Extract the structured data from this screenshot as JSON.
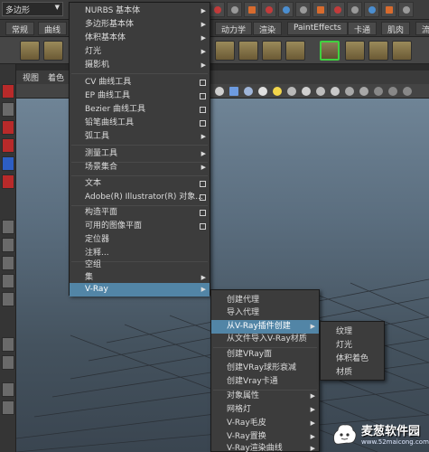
{
  "app": {
    "mode_dropdown": "多边形",
    "shelf_tabs": [
      "常规",
      "曲线",
      "动力学",
      "渲染",
      "PaintEffects",
      "卡通",
      "肌肉",
      "流"
    ],
    "panel_menu": [
      "视图",
      "着色"
    ]
  },
  "create_menu": {
    "items": [
      {
        "label": "NURBS 基本体",
        "submenu": true
      },
      {
        "label": "多边形基本体",
        "submenu": true
      },
      {
        "label": "体积基本体",
        "submenu": true
      },
      {
        "label": "灯光",
        "submenu": true
      },
      {
        "label": "摄影机",
        "submenu": true
      },
      {
        "label": "CV 曲线工具",
        "option_box": true
      },
      {
        "label": "EP 曲线工具",
        "option_box": true
      },
      {
        "label": "Bezier 曲线工具",
        "option_box": true
      },
      {
        "label": "铅笔曲线工具",
        "option_box": true
      },
      {
        "label": "弧工具",
        "submenu": true
      },
      {
        "label": "测量工具",
        "submenu": true
      },
      {
        "label": "场景集合",
        "submenu": true
      },
      {
        "label": "文本",
        "option_box": true
      },
      {
        "label": "Adobe(R) Illustrator(R) 对象...",
        "option_box": true
      },
      {
        "label": "构造平面",
        "option_box": true
      },
      {
        "label": "可用的图像平面",
        "option_box": true
      },
      {
        "label": "定位器"
      },
      {
        "label": "注释..."
      },
      {
        "label": "空组"
      },
      {
        "label": "集",
        "submenu": true
      },
      {
        "label": "V-Ray",
        "submenu": true,
        "highlighted": true
      }
    ]
  },
  "vray_menu": {
    "items": [
      {
        "label": "创建代理"
      },
      {
        "label": "导入代理"
      },
      {
        "label": "从V-Ray插件创建",
        "submenu": true,
        "highlighted": true
      },
      {
        "label": "从文件导入V-Ray材质"
      },
      {
        "label": "创建VRay面"
      },
      {
        "label": "创建VRay球形衰减"
      },
      {
        "label": "创建Vray卡通"
      },
      {
        "label": "对象属性",
        "submenu": true
      },
      {
        "label": "网格灯",
        "submenu": true
      },
      {
        "label": "V-Ray毛皮",
        "submenu": true
      },
      {
        "label": "V-Ray置换",
        "submenu": true
      },
      {
        "label": "V-Ray渲染曲线",
        "submenu": true
      }
    ]
  },
  "plugin_menu": {
    "items": [
      {
        "label": "纹理"
      },
      {
        "label": "灯光"
      },
      {
        "label": "体积着色"
      },
      {
        "label": "材质"
      }
    ]
  },
  "watermark": {
    "brand": "麦葱软件园",
    "url": "www.52maicong.com"
  }
}
